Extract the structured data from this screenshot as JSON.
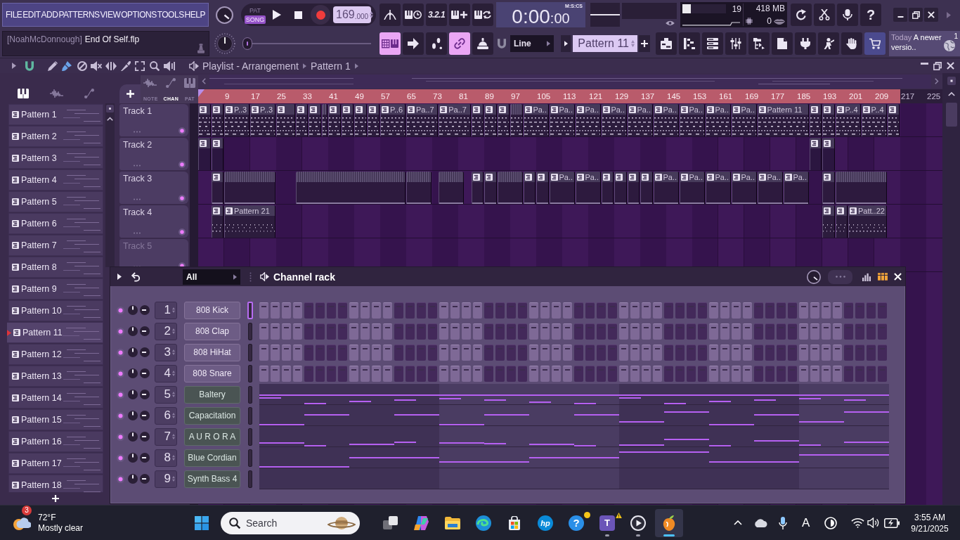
{
  "menu": [
    "FILE",
    "EDIT",
    "ADD",
    "PATTERNS",
    "VIEW",
    "OPTIONS",
    "TOOLS",
    "HELP"
  ],
  "transport": {
    "modes": [
      {
        "label": "PAT",
        "selected": false
      },
      {
        "label": "SONG",
        "selected": true
      }
    ],
    "tempo": "169",
    "tempo_fraction": ".000",
    "toggles": [
      {
        "kind": "metronome",
        "on": false
      },
      {
        "kind": "wait",
        "on": false
      },
      {
        "kind": "countdown",
        "label": "3.2.1",
        "on": false
      },
      {
        "kind": "step-edit",
        "on": false
      },
      {
        "kind": "loop-record",
        "on": false
      }
    ]
  },
  "time": {
    "main": "0:00",
    "fraction": ":00",
    "format": "M:S:CS"
  },
  "monitor": {
    "cpu": {
      "level": 0.19,
      "reading": "19"
    },
    "memory": "418 MB",
    "polyphony": "0"
  },
  "actions": [
    {
      "kind": "undo"
    },
    {
      "kind": "cut"
    },
    {
      "kind": "record-audio"
    },
    {
      "kind": "help",
      "label": "?"
    }
  ],
  "project": {
    "user": "[NoahMcDonnough]",
    "file": "End Of Self.flp"
  },
  "song_position": {
    "level": 0
  },
  "modes": [
    {
      "kind": "typing-keyboard",
      "on": true
    },
    {
      "kind": "arrow",
      "on": false
    },
    {
      "kind": "steps",
      "on": false
    },
    {
      "kind": "link",
      "on": true
    },
    {
      "kind": "dome",
      "on": false
    }
  ],
  "snap": "Line",
  "pattern_selector": "Pattern 11",
  "windows": [
    {
      "kind": "playlist"
    },
    {
      "kind": "piano-roll"
    },
    {
      "kind": "channel-rack"
    },
    {
      "kind": "mixer"
    },
    {
      "kind": "browser"
    },
    {
      "kind": "document"
    },
    {
      "kind": "plugin"
    },
    {
      "kind": "figure"
    },
    {
      "kind": "hand"
    },
    {
      "kind": "cart"
    }
  ],
  "news": {
    "date": "Today",
    "headline": "A newer versio..",
    "count": "1"
  },
  "playlist": {
    "breadcrumb": [
      "Playlist - Arrangement",
      "Pattern 1"
    ],
    "picker_tabs": [
      {
        "kind": "notes",
        "selected": true
      },
      {
        "kind": "audio",
        "selected": false
      },
      {
        "kind": "automation",
        "selected": false
      }
    ],
    "view_tabs": [
      {
        "label": "NOTE",
        "kind": "audio",
        "selected": false
      },
      {
        "label": "CHAN",
        "kind": "automation",
        "selected": true
      },
      {
        "label": "PAT",
        "kind": "notes",
        "selected": false
      }
    ],
    "patterns": [
      {
        "name": "Pattern 1",
        "selected": false
      },
      {
        "name": "Pattern 2",
        "selected": false
      },
      {
        "name": "Pattern 3",
        "selected": false
      },
      {
        "name": "Pattern 4",
        "selected": false
      },
      {
        "name": "Pattern 5",
        "selected": false
      },
      {
        "name": "Pattern 6",
        "selected": false
      },
      {
        "name": "Pattern 7",
        "selected": false
      },
      {
        "name": "Pattern 8",
        "selected": false
      },
      {
        "name": "Pattern 9",
        "selected": false
      },
      {
        "name": "Pattern 10",
        "selected": false
      },
      {
        "name": "Pattern 11",
        "selected": true
      },
      {
        "name": "Pattern 12",
        "selected": false
      },
      {
        "name": "Pattern 13",
        "selected": false
      },
      {
        "name": "Pattern 14",
        "selected": false
      },
      {
        "name": "Pattern 15",
        "selected": false
      },
      {
        "name": "Pattern 16",
        "selected": false
      },
      {
        "name": "Pattern 17",
        "selected": false
      },
      {
        "name": "Pattern 18",
        "selected": false
      }
    ],
    "ruler": [
      {
        "label": "9",
        "in_song": true
      },
      {
        "label": "17",
        "in_song": true
      },
      {
        "label": "25",
        "in_song": true
      },
      {
        "label": "33",
        "in_song": true
      },
      {
        "label": "41",
        "in_song": true
      },
      {
        "label": "49",
        "in_song": true
      },
      {
        "label": "57",
        "in_song": true
      },
      {
        "label": "65",
        "in_song": true
      },
      {
        "label": "73",
        "in_song": true
      },
      {
        "label": "81",
        "in_song": true
      },
      {
        "label": "89",
        "in_song": true
      },
      {
        "label": "97",
        "in_song": true
      },
      {
        "label": "105",
        "in_song": true
      },
      {
        "label": "113",
        "in_song": true
      },
      {
        "label": "121",
        "in_song": true
      },
      {
        "label": "129",
        "in_song": true
      },
      {
        "label": "137",
        "in_song": true
      },
      {
        "label": "145",
        "in_song": true
      },
      {
        "label": "153",
        "in_song": true
      },
      {
        "label": "161",
        "in_song": true
      },
      {
        "label": "169",
        "in_song": true
      },
      {
        "label": "177",
        "in_song": true
      },
      {
        "label": "185",
        "in_song": true
      },
      {
        "label": "193",
        "in_song": true
      },
      {
        "label": "201",
        "in_song": true
      },
      {
        "label": "209",
        "in_song": true
      },
      {
        "label": "217",
        "in_song": false
      },
      {
        "label": "225",
        "in_song": false
      }
    ],
    "tracks": [
      {
        "name": "Track 1",
        "clips": [
          {
            "kind": "pattern"
          },
          {
            "kind": "pattern"
          },
          {
            "kind": "pattern",
            "label": "P..3"
          },
          {
            "kind": "pattern",
            "label": "P..3"
          },
          {
            "kind": "pattern"
          },
          {
            "kind": "pattern"
          },
          {
            "kind": "pattern"
          },
          {
            "kind": "stack"
          },
          {
            "kind": "pattern"
          },
          {
            "kind": "pattern"
          },
          {
            "kind": "pattern"
          },
          {
            "kind": "pattern"
          },
          {
            "kind": "pattern",
            "label": "P..6"
          },
          {
            "kind": "pattern",
            "label": "Pa..7"
          },
          {
            "kind": "pattern",
            "label": "Pa..7"
          },
          {
            "kind": "pattern"
          },
          {
            "kind": "pattern"
          },
          {
            "kind": "pattern"
          },
          {
            "kind": "stack"
          },
          {
            "kind": "pattern",
            "label": "Pa.."
          },
          {
            "kind": "pattern",
            "label": "Pa.."
          },
          {
            "kind": "pattern",
            "label": "Pa.."
          },
          {
            "kind": "pattern",
            "label": "Pa.."
          },
          {
            "kind": "pattern",
            "label": "Pa.."
          },
          {
            "kind": "pattern",
            "label": "Pa.."
          },
          {
            "kind": "pattern",
            "label": "Pa.."
          },
          {
            "kind": "pattern",
            "label": "Pa.."
          },
          {
            "kind": "pattern",
            "label": "Pa.."
          },
          {
            "kind": "pattern",
            "label": "Pattern 11"
          },
          {
            "kind": "pattern"
          },
          {
            "kind": "pattern"
          },
          {
            "kind": "pattern",
            "label": "P..4"
          },
          {
            "kind": "pattern",
            "label": "P..4"
          },
          {
            "kind": "pattern"
          }
        ]
      },
      {
        "name": "Track 2",
        "clips": [
          {
            "kind": "pattern"
          },
          {
            "kind": "pattern"
          },
          {
            "kind": "pattern"
          },
          {
            "kind": "pattern"
          }
        ]
      },
      {
        "name": "Track 3",
        "clips": [
          {
            "kind": "pattern"
          },
          {
            "kind": "stack"
          },
          {
            "kind": "stack"
          },
          {
            "kind": "stack"
          },
          {
            "kind": "stack"
          },
          {
            "kind": "pattern"
          },
          {
            "kind": "pattern"
          },
          {
            "kind": "stack"
          },
          {
            "kind": "pattern"
          },
          {
            "kind": "pattern"
          },
          {
            "kind": "pattern",
            "label": "Pa.."
          },
          {
            "kind": "pattern",
            "label": "Pa.."
          },
          {
            "kind": "pattern"
          },
          {
            "kind": "pattern"
          },
          {
            "kind": "pattern"
          },
          {
            "kind": "pattern"
          },
          {
            "kind": "pattern",
            "label": "Pa.."
          },
          {
            "kind": "pattern",
            "label": "Pa.."
          },
          {
            "kind": "pattern",
            "label": "Pa.."
          },
          {
            "kind": "pattern",
            "label": "Pa.."
          },
          {
            "kind": "pattern",
            "label": "Pa.."
          },
          {
            "kind": "pattern",
            "label": "Pa.."
          },
          {
            "kind": "pattern"
          },
          {
            "kind": "stack"
          }
        ]
      },
      {
        "name": "Track 4",
        "clips": [
          {
            "kind": "pattern"
          },
          {
            "kind": "pattern",
            "label": "Pattern 21"
          },
          {
            "kind": "pattern"
          },
          {
            "kind": "pattern"
          },
          {
            "kind": "pattern",
            "label": "Patt..22"
          }
        ]
      },
      {
        "name": "Track 5"
      }
    ]
  },
  "channel_rack": {
    "filter": "All",
    "title": "Channel rack",
    "channels": [
      {
        "number": "1",
        "name": "808 Kick",
        "kind": "steps",
        "enabled": true,
        "selected": true,
        "steps": [
          false,
          false,
          false,
          false,
          false,
          false,
          false,
          false,
          false,
          false,
          false,
          false,
          false,
          false,
          false,
          false,
          false,
          false,
          false,
          false,
          false,
          false,
          false,
          false,
          false,
          false,
          false,
          false,
          false,
          false,
          false,
          false,
          false,
          false,
          false,
          false,
          false,
          false,
          false,
          false,
          false,
          false,
          false,
          false,
          false,
          false,
          false,
          false,
          false,
          false,
          false,
          false,
          false,
          false,
          false,
          false
        ]
      },
      {
        "number": "2",
        "name": "808 Clap",
        "kind": "steps",
        "enabled": true,
        "selected": false,
        "steps": [
          false,
          false,
          false,
          false,
          false,
          false,
          false,
          false,
          false,
          false,
          false,
          false,
          false,
          false,
          false,
          false,
          false,
          false,
          false,
          false,
          false,
          false,
          false,
          false,
          false,
          false,
          false,
          false,
          false,
          false,
          false,
          false,
          false,
          false,
          false,
          false,
          false,
          false,
          false,
          false,
          false,
          false,
          false,
          false,
          false,
          false,
          false,
          false,
          false,
          false,
          false,
          false,
          false,
          false,
          false,
          false
        ]
      },
      {
        "number": "3",
        "name": "808 HiHat",
        "kind": "steps",
        "enabled": true,
        "selected": false,
        "steps": [
          false,
          false,
          false,
          false,
          false,
          false,
          false,
          false,
          false,
          false,
          false,
          false,
          false,
          false,
          false,
          false,
          false,
          false,
          false,
          false,
          false,
          false,
          false,
          false,
          false,
          false,
          false,
          false,
          false,
          false,
          false,
          false,
          false,
          false,
          false,
          false,
          false,
          false,
          false,
          false,
          false,
          false,
          false,
          false,
          false,
          false,
          false,
          false,
          false,
          false,
          false,
          false,
          false,
          false,
          false,
          false
        ]
      },
      {
        "number": "4",
        "name": "808 Snare",
        "kind": "steps",
        "enabled": true,
        "selected": false,
        "steps": [
          false,
          false,
          false,
          false,
          false,
          false,
          false,
          false,
          false,
          false,
          false,
          false,
          false,
          false,
          false,
          false,
          false,
          false,
          false,
          false,
          false,
          false,
          false,
          false,
          false,
          false,
          false,
          false,
          false,
          false,
          false,
          false,
          false,
          false,
          false,
          false,
          false,
          false,
          false,
          false,
          false,
          false,
          false,
          false,
          false,
          false,
          false,
          false,
          false,
          false,
          false,
          false,
          false,
          false,
          false,
          false
        ]
      },
      {
        "number": "5",
        "name": "Baltery",
        "kind": "notes",
        "enabled": true,
        "selected": false
      },
      {
        "number": "6",
        "name": "Capacitation",
        "kind": "notes",
        "enabled": true,
        "selected": false
      },
      {
        "number": "7",
        "name": "A U R O R A",
        "kind": "notes",
        "enabled": true,
        "selected": false
      },
      {
        "number": "8",
        "name": "Blue Cordian",
        "kind": "notes",
        "enabled": true,
        "selected": false
      },
      {
        "number": "9",
        "name": "Synth Bass 4",
        "kind": "notes",
        "enabled": true,
        "selected": false
      }
    ]
  },
  "taskbar": {
    "weather": {
      "badge": "3",
      "temperature": "72°F",
      "condition": "Mostly clear"
    },
    "search": {
      "placeholder": "Search"
    },
    "apps": [
      {
        "kind": "task-view",
        "running": false,
        "active": false
      },
      {
        "kind": "copilot",
        "running": false,
        "active": false
      },
      {
        "kind": "folder",
        "running": false,
        "active": false
      },
      {
        "kind": "browser",
        "running": false,
        "active": false
      },
      {
        "kind": "store",
        "running": false,
        "active": false
      },
      {
        "kind": "logo",
        "label": "hp",
        "running": false,
        "active": false
      },
      {
        "kind": "help",
        "label": "?",
        "running": false,
        "active": false
      },
      {
        "kind": "chat",
        "label": "T",
        "running": true,
        "active": false
      },
      {
        "kind": "media",
        "running": true,
        "active": false
      },
      {
        "kind": "studio",
        "running": true,
        "active": true
      }
    ],
    "input_indicator": "A",
    "clock": {
      "time": "3:55 AM",
      "date": "9/21/2025"
    }
  }
}
